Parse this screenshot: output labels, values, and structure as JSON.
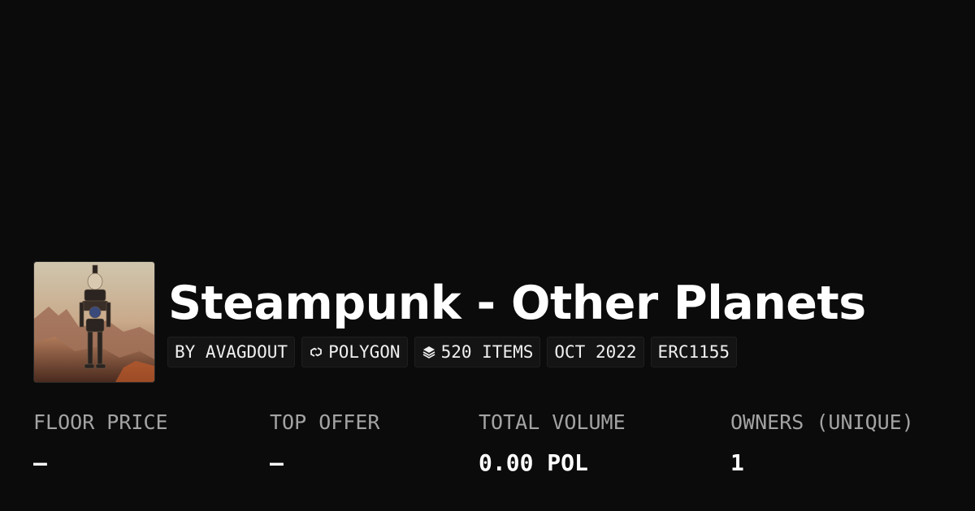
{
  "collection": {
    "title": "Steampunk - Other Planets",
    "image": {
      "alt": "steampunk-robot-artwork"
    }
  },
  "tags": [
    {
      "label": "BY AVAGDOUT",
      "icon": ""
    },
    {
      "label": "POLYGON",
      "icon": "polygon-chain-icon"
    },
    {
      "label": "520 ITEMS",
      "icon": "layers-icon"
    },
    {
      "label": "OCT 2022",
      "icon": ""
    },
    {
      "label": "ERC1155",
      "icon": ""
    }
  ],
  "stats": [
    {
      "label": "FLOOR PRICE",
      "value": "–"
    },
    {
      "label": "TOP OFFER",
      "value": "–"
    },
    {
      "label": "TOTAL VOLUME",
      "value": "0.00 POL"
    },
    {
      "label": "OWNERS (UNIQUE)",
      "value": "1"
    }
  ],
  "colors": {
    "background": "#0b0b0b",
    "text": "#ffffff",
    "muted": "#a3a3a3",
    "tag_bg": "#141414"
  }
}
